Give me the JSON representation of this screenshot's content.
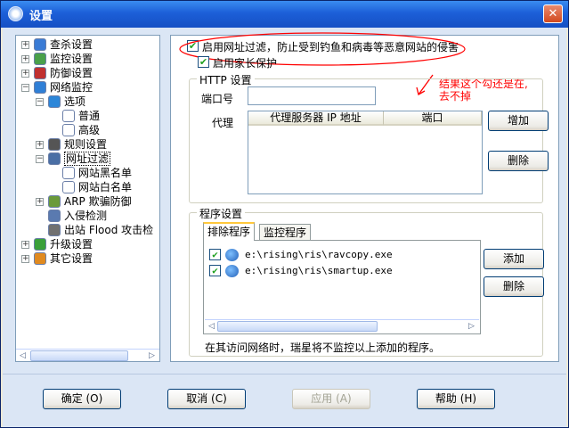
{
  "window": {
    "title": "设置",
    "close_glyph": "✕"
  },
  "tree": {
    "items": [
      {
        "label": "查杀设置",
        "toggle": "+",
        "icon": "magnifier-icon",
        "color": "#3a7bd5"
      },
      {
        "label": "监控设置",
        "toggle": "+",
        "icon": "monitor-icon",
        "color": "#4aa04a"
      },
      {
        "label": "防御设置",
        "toggle": "+",
        "icon": "shield-icon",
        "color": "#c03030"
      },
      {
        "label": "网络监控",
        "toggle": "−",
        "icon": "globe-icon",
        "color": "#2f7fd6"
      },
      {
        "label": "选项",
        "toggle": "−",
        "icon": "gear-icon",
        "color": "#2c86d9"
      },
      {
        "label": "普通",
        "toggle": "",
        "icon": "page-icon",
        "color": "#ffffff"
      },
      {
        "label": "高级",
        "toggle": "",
        "icon": "page-icon",
        "color": "#ffffff"
      },
      {
        "label": "规则设置",
        "toggle": "+",
        "icon": "rules-icon",
        "color": "#555555"
      },
      {
        "label": "网址过滤",
        "toggle": "−",
        "icon": "filter-icon",
        "color": "#4a6fa5"
      },
      {
        "label": "网站黑名单",
        "toggle": "",
        "icon": "page-icon",
        "color": "#ffffff"
      },
      {
        "label": "网站白名单",
        "toggle": "",
        "icon": "page-icon",
        "color": "#ffffff"
      },
      {
        "label": "ARP 欺骗防御",
        "toggle": "+",
        "icon": "arp-icon",
        "color": "#6a9a3a"
      },
      {
        "label": "入侵检测",
        "toggle": "",
        "icon": "intrusion-icon",
        "color": "#5a7ab0"
      },
      {
        "label": "出站 Flood 攻击检",
        "toggle": "",
        "icon": "flood-icon",
        "color": "#707070"
      },
      {
        "label": "升级设置",
        "toggle": "+",
        "icon": "upgrade-icon",
        "color": "#3aa03a"
      },
      {
        "label": "其它设置",
        "toggle": "+",
        "icon": "misc-icon",
        "color": "#e08a20"
      }
    ]
  },
  "url_filter": {
    "enable_label": "启用网址过滤，防止受到钓鱼和病毒等恶意网站的侵害",
    "enable_checked": true,
    "parental_label": "启用家长保护",
    "parental_checked": true,
    "check_glyph": "✔"
  },
  "http": {
    "group_title": "HTTP 设置",
    "port_label": "端口号",
    "port_value": "",
    "proxy_label": "代理",
    "columns": [
      "代理服务器 IP 地址",
      "端口"
    ],
    "add_button": "增加",
    "delete_button": "删除"
  },
  "programs": {
    "group_title": "程序设置",
    "tabs": [
      "排除程序",
      "监控程序"
    ],
    "active_tab": 0,
    "rows": [
      {
        "checked": true,
        "path": "e:\\rising\\ris\\ravcopy.exe"
      },
      {
        "checked": true,
        "path": "e:\\rising\\ris\\smartup.exe"
      }
    ],
    "add_button": "添加",
    "delete_button": "删除",
    "note": "在其访问网络时，瑞星将不监控以上添加的程序。"
  },
  "annotation": {
    "line1": "结果这个勾还是在,",
    "line2": "去不掉",
    "color": "#ff0000"
  },
  "footer": {
    "ok": "确定 (O)",
    "cancel": "取消 (C)",
    "apply": "应用 (A)",
    "help": "帮助 (H)"
  },
  "scroll": {
    "left_arrow": "◁",
    "right_arrow": "▷"
  }
}
